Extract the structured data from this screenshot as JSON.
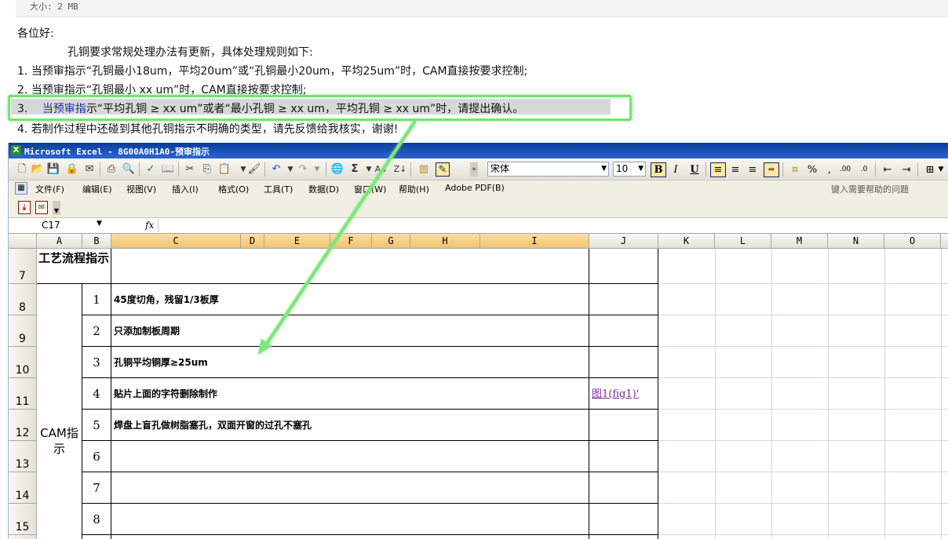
{
  "email": {
    "attachment_size": "大小: 2 MB",
    "greeting": "各位好:",
    "intro": "孔铜要求常规处理办法有更新，具体处理规则如下:",
    "rules": [
      "1. 当预审指示“孔铜最小18um，平均20um”或“孔铜最小20um，平均25um”时，CAM直接按要求控制;",
      "2. 当预审指示“孔铜最小 xx um”时，CAM直接按要求控制;",
      "3.",
      "4. 若制作过程中还碰到其他孔铜指示不明确的类型，请先反馈给我核实，谢谢!"
    ],
    "rule3_blue": "当预审指",
    "rule3_rest": "示“平均孔铜 ≥ xx um”或者“最小孔铜 ≥ xx um，平均孔铜 ≥ xx um”时，请提出确认。"
  },
  "excel": {
    "window_title": "Microsoft Excel - 8G00A0H1A0-预审指示",
    "app_icon": "X",
    "font_name": "宋体",
    "font_size": "10",
    "menus": [
      "文件(F)",
      "编辑(E)",
      "视图(V)",
      "插入(I)",
      "格式(O)",
      "工具(T)",
      "数据(D)",
      "窗口(W)",
      "帮助(H)",
      "Adobe PDF(B)"
    ],
    "help_placeholder": "键入需要帮助的问题",
    "name_box": "C17",
    "fx": "fx",
    "columns": [
      "A",
      "B",
      "C",
      "D",
      "E",
      "F",
      "G",
      "H",
      "I",
      "J",
      "K",
      "L",
      "M",
      "N",
      "O"
    ],
    "rows": [
      "7",
      "8",
      "9",
      "10",
      "11",
      "12",
      "13",
      "14",
      "15"
    ],
    "process_header": "工艺流程指示",
    "cam_label": "CAM指示",
    "items": [
      {
        "num": "1",
        "text": "45度切角，残留1/3板厚"
      },
      {
        "num": "2",
        "text": "只添加制板周期"
      },
      {
        "num": "3",
        "text": "孔铜平均铜厚≥25um"
      },
      {
        "num": "4",
        "text": "贴片上面的字符删除制作"
      },
      {
        "num": "5",
        "text": "焊盘上盲孔做树脂塞孔，双面开窗的过孔不塞孔"
      },
      {
        "num": "6",
        "text": ""
      },
      {
        "num": "7",
        "text": ""
      },
      {
        "num": "8",
        "text": ""
      }
    ],
    "j_link": "图1(fig1)'",
    "toolbar_icons": [
      "new-icon",
      "open-icon",
      "save-icon",
      "permission-icon",
      "email-icon",
      "print-icon",
      "print-preview-icon",
      "spelling-icon",
      "research-icon",
      "cut-icon",
      "copy-icon",
      "paste-icon",
      "format-painter-icon",
      "undo-icon",
      "redo-icon",
      "hyperlink-icon",
      "autosum-icon",
      "sort-asc-icon",
      "sort-desc-icon",
      "chart-icon",
      "drawing-icon"
    ],
    "colors": {
      "title_bar": "#0a3c9a",
      "highlight_box": "#6ee86a",
      "link": "#7a2a9a",
      "selected_col": "#f3c26c"
    }
  }
}
